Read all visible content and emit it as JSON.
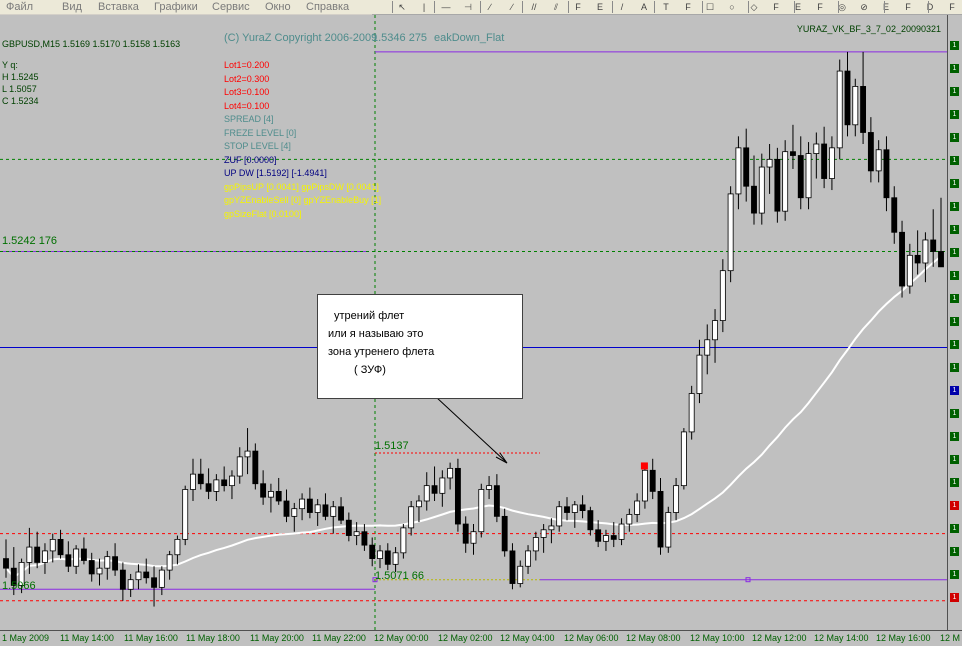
{
  "menu": {
    "items": [
      "Файл",
      "Вид",
      "Вставка",
      "Графики",
      "Сервис",
      "Окно",
      "Справка"
    ]
  },
  "toolbar": {
    "buttons": [
      "↖",
      "|",
      "—",
      "⊣",
      "∕",
      "∕",
      "//",
      "⫽",
      "F",
      "E",
      "/",
      "A",
      "T",
      "F",
      "☐",
      "○",
      "◇",
      "F",
      "E",
      "F",
      "◎",
      "⊘",
      "E",
      "F",
      "D",
      "F"
    ]
  },
  "chart": {
    "symbol_header": "GBPUSD,M15  1.5169 1.5170 1.5158 1.5163",
    "indicator_name": "YURAZ_VK_BF_3_7_02_20090321",
    "copyright": "(C) YuraZ Copyright 2006-2009",
    "overlay_number": "1.5346 275",
    "overlay_name": "eakDown_Flat",
    "ohlc": [
      "Y q:",
      "H 1.5245",
      "L 1.5057",
      "C 1.5234"
    ],
    "info": [
      {
        "text": "Lot1=0.200",
        "color": "#ff0000"
      },
      {
        "text": "Lot2=0.300",
        "color": "#ff0000"
      },
      {
        "text": "Lot3=0.100",
        "color": "#ff0000"
      },
      {
        "text": "Lot4=0.100",
        "color": "#ff0000"
      },
      {
        "text": "SPREAD      [4]",
        "color": "#4e8c8c"
      },
      {
        "text": "FREZE LEVEL [0]",
        "color": "#4e8c8c"
      },
      {
        "text": "STOP LEVEL  [4]",
        "color": "#4e8c8c"
      },
      {
        "text": "ZUF      [0.0000]",
        "color": "#000080"
      },
      {
        "text": "UP DW     [1.5192]  [-1.4941]",
        "color": "#000080"
      },
      {
        "text": "gpPipsUP [0.0041] gpPipsDW [0.0041]",
        "color": "#f5f500"
      },
      {
        "text": "gpYZEnableSell [0] gpYZEnableBuy [1]",
        "color": "#f5f500"
      },
      {
        "text": "gpSizeFlat [0.0100]",
        "color": "#f5f500"
      }
    ],
    "level_labels": {
      "high": "1.5242 176",
      "flat_top": "1.5137",
      "flat_bottom": "1.5071 66",
      "low": "1.5066"
    },
    "annotation": [
      "утрений флет",
      "или я называю это",
      "зона утренего флета",
      "( ЗУФ)"
    ],
    "time_labels": [
      "1 May 2009",
      "11 May 14:00",
      "11 May 16:00",
      "11 May 18:00",
      "11 May 20:00",
      "11 May 22:00",
      "12 May 00:00",
      "12 May 02:00",
      "12 May 04:00",
      "12 May 06:00",
      "12 May 08:00",
      "12 May 10:00",
      "12 May 12:00",
      "12 May 14:00",
      "12 May 16:00",
      "12 M"
    ],
    "price_scale_marks": [
      "1",
      "1",
      "1",
      "1",
      "1",
      "1",
      "1",
      "1",
      "1",
      "1",
      "1",
      "1",
      "1",
      "1",
      "1",
      "1",
      "1",
      "1",
      "1",
      "1",
      "1",
      "1",
      "1",
      "1",
      "1"
    ],
    "colors": {
      "background": "#c0c0c0",
      "bull_candle": "#ffffff",
      "bear_candle": "#000000",
      "ma_line": "#ffffff",
      "purple_level": "#8a2be2",
      "blue_level": "#0000cc",
      "red_level": "#ff0000",
      "green_level": "#008000",
      "yellow_level": "#b8b800",
      "grid": "#008000"
    }
  },
  "chart_data": {
    "type": "candlestick",
    "symbol": "GBPUSD",
    "timeframe": "M15",
    "candles": [
      {
        "o": 1.5082,
        "h": 1.5092,
        "l": 1.5072,
        "c": 1.5077
      },
      {
        "o": 1.5077,
        "h": 1.5088,
        "l": 1.5063,
        "c": 1.5068
      },
      {
        "o": 1.5068,
        "h": 1.5082,
        "l": 1.5064,
        "c": 1.508
      },
      {
        "o": 1.508,
        "h": 1.5098,
        "l": 1.5074,
        "c": 1.5088
      },
      {
        "o": 1.5088,
        "h": 1.5096,
        "l": 1.5077,
        "c": 1.508
      },
      {
        "o": 1.508,
        "h": 1.509,
        "l": 1.5074,
        "c": 1.5086
      },
      {
        "o": 1.5086,
        "h": 1.5095,
        "l": 1.508,
        "c": 1.5092
      },
      {
        "o": 1.5092,
        "h": 1.5097,
        "l": 1.5082,
        "c": 1.5084
      },
      {
        "o": 1.5084,
        "h": 1.5091,
        "l": 1.5075,
        "c": 1.5078
      },
      {
        "o": 1.5078,
        "h": 1.5089,
        "l": 1.5074,
        "c": 1.5087
      },
      {
        "o": 1.5087,
        "h": 1.5093,
        "l": 1.5079,
        "c": 1.5081
      },
      {
        "o": 1.5081,
        "h": 1.5085,
        "l": 1.507,
        "c": 1.5074
      },
      {
        "o": 1.5074,
        "h": 1.5082,
        "l": 1.5068,
        "c": 1.5077
      },
      {
        "o": 1.5077,
        "h": 1.5086,
        "l": 1.5071,
        "c": 1.5083
      },
      {
        "o": 1.5083,
        "h": 1.509,
        "l": 1.5073,
        "c": 1.5076
      },
      {
        "o": 1.5076,
        "h": 1.508,
        "l": 1.506,
        "c": 1.5066
      },
      {
        "o": 1.5066,
        "h": 1.5074,
        "l": 1.5062,
        "c": 1.5071
      },
      {
        "o": 1.5071,
        "h": 1.5079,
        "l": 1.5066,
        "c": 1.5075
      },
      {
        "o": 1.5075,
        "h": 1.5082,
        "l": 1.5069,
        "c": 1.5072
      },
      {
        "o": 1.5072,
        "h": 1.5078,
        "l": 1.5057,
        "c": 1.5067
      },
      {
        "o": 1.5067,
        "h": 1.5078,
        "l": 1.5063,
        "c": 1.5076
      },
      {
        "o": 1.5076,
        "h": 1.5086,
        "l": 1.5071,
        "c": 1.5084
      },
      {
        "o": 1.5084,
        "h": 1.5094,
        "l": 1.5079,
        "c": 1.5092
      },
      {
        "o": 1.5092,
        "h": 1.512,
        "l": 1.5089,
        "c": 1.5118
      },
      {
        "o": 1.5118,
        "h": 1.5134,
        "l": 1.5112,
        "c": 1.5126
      },
      {
        "o": 1.5126,
        "h": 1.5134,
        "l": 1.5118,
        "c": 1.5121
      },
      {
        "o": 1.5121,
        "h": 1.5129,
        "l": 1.5113,
        "c": 1.5117
      },
      {
        "o": 1.5117,
        "h": 1.5126,
        "l": 1.5112,
        "c": 1.5123
      },
      {
        "o": 1.5123,
        "h": 1.513,
        "l": 1.5117,
        "c": 1.512
      },
      {
        "o": 1.512,
        "h": 1.5128,
        "l": 1.5113,
        "c": 1.5125
      },
      {
        "o": 1.5125,
        "h": 1.514,
        "l": 1.5121,
        "c": 1.5135
      },
      {
        "o": 1.5135,
        "h": 1.515,
        "l": 1.5126,
        "c": 1.5138
      },
      {
        "o": 1.5138,
        "h": 1.5142,
        "l": 1.5118,
        "c": 1.5121
      },
      {
        "o": 1.5121,
        "h": 1.5128,
        "l": 1.511,
        "c": 1.5114
      },
      {
        "o": 1.5114,
        "h": 1.5121,
        "l": 1.5106,
        "c": 1.5117
      },
      {
        "o": 1.5117,
        "h": 1.5124,
        "l": 1.511,
        "c": 1.5112
      },
      {
        "o": 1.5112,
        "h": 1.5118,
        "l": 1.5101,
        "c": 1.5104
      },
      {
        "o": 1.5104,
        "h": 1.5111,
        "l": 1.5096,
        "c": 1.5108
      },
      {
        "o": 1.5108,
        "h": 1.5116,
        "l": 1.5102,
        "c": 1.5113
      },
      {
        "o": 1.5113,
        "h": 1.5119,
        "l": 1.5103,
        "c": 1.5106
      },
      {
        "o": 1.5106,
        "h": 1.5113,
        "l": 1.5099,
        "c": 1.511
      },
      {
        "o": 1.511,
        "h": 1.5116,
        "l": 1.5102,
        "c": 1.5104
      },
      {
        "o": 1.5104,
        "h": 1.5112,
        "l": 1.5095,
        "c": 1.5109
      },
      {
        "o": 1.5109,
        "h": 1.5114,
        "l": 1.51,
        "c": 1.5102
      },
      {
        "o": 1.5102,
        "h": 1.5106,
        "l": 1.5091,
        "c": 1.5094
      },
      {
        "o": 1.5094,
        "h": 1.5101,
        "l": 1.5089,
        "c": 1.5096
      },
      {
        "o": 1.5096,
        "h": 1.51,
        "l": 1.5086,
        "c": 1.5089
      },
      {
        "o": 1.5089,
        "h": 1.5093,
        "l": 1.5078,
        "c": 1.5082
      },
      {
        "o": 1.5082,
        "h": 1.5089,
        "l": 1.5077,
        "c": 1.5086
      },
      {
        "o": 1.5086,
        "h": 1.509,
        "l": 1.5076,
        "c": 1.5079
      },
      {
        "o": 1.5079,
        "h": 1.5088,
        "l": 1.5075,
        "c": 1.5085
      },
      {
        "o": 1.5085,
        "h": 1.51,
        "l": 1.5082,
        "c": 1.5098
      },
      {
        "o": 1.5098,
        "h": 1.5112,
        "l": 1.5094,
        "c": 1.5109
      },
      {
        "o": 1.5109,
        "h": 1.5115,
        "l": 1.5101,
        "c": 1.5112
      },
      {
        "o": 1.5112,
        "h": 1.5127,
        "l": 1.5107,
        "c": 1.512
      },
      {
        "o": 1.512,
        "h": 1.513,
        "l": 1.5112,
        "c": 1.5116
      },
      {
        "o": 1.5116,
        "h": 1.5128,
        "l": 1.5109,
        "c": 1.5124
      },
      {
        "o": 1.5124,
        "h": 1.5132,
        "l": 1.5118,
        "c": 1.5129
      },
      {
        "o": 1.5129,
        "h": 1.5134,
        "l": 1.5096,
        "c": 1.51
      },
      {
        "o": 1.51,
        "h": 1.5104,
        "l": 1.5085,
        "c": 1.509
      },
      {
        "o": 1.509,
        "h": 1.51,
        "l": 1.5084,
        "c": 1.5096
      },
      {
        "o": 1.5096,
        "h": 1.5121,
        "l": 1.5093,
        "c": 1.5118
      },
      {
        "o": 1.5118,
        "h": 1.5125,
        "l": 1.5113,
        "c": 1.512
      },
      {
        "o": 1.512,
        "h": 1.5126,
        "l": 1.5101,
        "c": 1.5104
      },
      {
        "o": 1.5104,
        "h": 1.5108,
        "l": 1.5083,
        "c": 1.5086
      },
      {
        "o": 1.5086,
        "h": 1.509,
        "l": 1.5066,
        "c": 1.5069
      },
      {
        "o": 1.5069,
        "h": 1.5081,
        "l": 1.5067,
        "c": 1.5078
      },
      {
        "o": 1.5078,
        "h": 1.5089,
        "l": 1.5074,
        "c": 1.5086
      },
      {
        "o": 1.5086,
        "h": 1.5096,
        "l": 1.5081,
        "c": 1.5093
      },
      {
        "o": 1.5093,
        "h": 1.51,
        "l": 1.5085,
        "c": 1.5097
      },
      {
        "o": 1.5097,
        "h": 1.5103,
        "l": 1.509,
        "c": 1.5099
      },
      {
        "o": 1.5099,
        "h": 1.5112,
        "l": 1.5096,
        "c": 1.5109
      },
      {
        "o": 1.5109,
        "h": 1.5114,
        "l": 1.5102,
        "c": 1.5106
      },
      {
        "o": 1.5106,
        "h": 1.5112,
        "l": 1.5098,
        "c": 1.511
      },
      {
        "o": 1.511,
        "h": 1.5115,
        "l": 1.5103,
        "c": 1.5107
      },
      {
        "o": 1.5107,
        "h": 1.5109,
        "l": 1.5094,
        "c": 1.5097
      },
      {
        "o": 1.5097,
        "h": 1.5102,
        "l": 1.5088,
        "c": 1.5091
      },
      {
        "o": 1.5091,
        "h": 1.5097,
        "l": 1.5086,
        "c": 1.5094
      },
      {
        "o": 1.5094,
        "h": 1.5101,
        "l": 1.5088,
        "c": 1.5092
      },
      {
        "o": 1.5092,
        "h": 1.5103,
        "l": 1.5089,
        "c": 1.51
      },
      {
        "o": 1.51,
        "h": 1.5108,
        "l": 1.5096,
        "c": 1.5105
      },
      {
        "o": 1.5105,
        "h": 1.5116,
        "l": 1.5101,
        "c": 1.5112
      },
      {
        "o": 1.5112,
        "h": 1.5132,
        "l": 1.5108,
        "c": 1.5128
      },
      {
        "o": 1.5128,
        "h": 1.5134,
        "l": 1.5113,
        "c": 1.5117
      },
      {
        "o": 1.5117,
        "h": 1.5124,
        "l": 1.5084,
        "c": 1.5088
      },
      {
        "o": 1.5088,
        "h": 1.5109,
        "l": 1.5085,
        "c": 1.5106
      },
      {
        "o": 1.5106,
        "h": 1.5124,
        "l": 1.5102,
        "c": 1.512
      },
      {
        "o": 1.512,
        "h": 1.515,
        "l": 1.5118,
        "c": 1.5148
      },
      {
        "o": 1.5148,
        "h": 1.5172,
        "l": 1.5144,
        "c": 1.5168
      },
      {
        "o": 1.5168,
        "h": 1.5196,
        "l": 1.5163,
        "c": 1.5188
      },
      {
        "o": 1.5188,
        "h": 1.5204,
        "l": 1.5178,
        "c": 1.5196
      },
      {
        "o": 1.5196,
        "h": 1.5212,
        "l": 1.5184,
        "c": 1.5206
      },
      {
        "o": 1.5206,
        "h": 1.5238,
        "l": 1.52,
        "c": 1.5232
      },
      {
        "o": 1.5232,
        "h": 1.5276,
        "l": 1.5226,
        "c": 1.5272
      },
      {
        "o": 1.5272,
        "h": 1.5302,
        "l": 1.5264,
        "c": 1.5296
      },
      {
        "o": 1.5296,
        "h": 1.5306,
        "l": 1.5268,
        "c": 1.5276
      },
      {
        "o": 1.5276,
        "h": 1.5292,
        "l": 1.5256,
        "c": 1.5262
      },
      {
        "o": 1.5262,
        "h": 1.5293,
        "l": 1.5256,
        "c": 1.5286
      },
      {
        "o": 1.5286,
        "h": 1.5298,
        "l": 1.5272,
        "c": 1.529
      },
      {
        "o": 1.529,
        "h": 1.5296,
        "l": 1.5257,
        "c": 1.5263
      },
      {
        "o": 1.5263,
        "h": 1.53,
        "l": 1.5258,
        "c": 1.5294
      },
      {
        "o": 1.5294,
        "h": 1.5308,
        "l": 1.5285,
        "c": 1.5292
      },
      {
        "o": 1.5292,
        "h": 1.5302,
        "l": 1.5264,
        "c": 1.527
      },
      {
        "o": 1.527,
        "h": 1.5299,
        "l": 1.5264,
        "c": 1.5293
      },
      {
        "o": 1.5293,
        "h": 1.5304,
        "l": 1.528,
        "c": 1.5298
      },
      {
        "o": 1.5298,
        "h": 1.5307,
        "l": 1.5275,
        "c": 1.528
      },
      {
        "o": 1.528,
        "h": 1.5302,
        "l": 1.5274,
        "c": 1.5296
      },
      {
        "o": 1.5296,
        "h": 1.5342,
        "l": 1.529,
        "c": 1.5336
      },
      {
        "o": 1.5336,
        "h": 1.5346,
        "l": 1.5302,
        "c": 1.5308
      },
      {
        "o": 1.5308,
        "h": 1.5332,
        "l": 1.5302,
        "c": 1.5328
      },
      {
        "o": 1.5328,
        "h": 1.5346,
        "l": 1.5298,
        "c": 1.5304
      },
      {
        "o": 1.5304,
        "h": 1.5312,
        "l": 1.5278,
        "c": 1.5284
      },
      {
        "o": 1.5284,
        "h": 1.53,
        "l": 1.5278,
        "c": 1.5295
      },
      {
        "o": 1.5295,
        "h": 1.5302,
        "l": 1.5263,
        "c": 1.527
      },
      {
        "o": 1.527,
        "h": 1.5276,
        "l": 1.5246,
        "c": 1.5252
      },
      {
        "o": 1.5252,
        "h": 1.5258,
        "l": 1.5218,
        "c": 1.5224
      },
      {
        "o": 1.5224,
        "h": 1.5246,
        "l": 1.522,
        "c": 1.524
      },
      {
        "o": 1.524,
        "h": 1.5253,
        "l": 1.523,
        "c": 1.5236
      },
      {
        "o": 1.5236,
        "h": 1.5252,
        "l": 1.5226,
        "c": 1.5248
      },
      {
        "o": 1.5248,
        "h": 1.5264,
        "l": 1.5234,
        "c": 1.5242
      },
      {
        "o": 1.5242,
        "h": 1.527,
        "l": 1.5236,
        "c": 1.5234
      }
    ],
    "levels": [
      {
        "name": "upper-purple",
        "price": 1.5346
      },
      {
        "name": "mid-green",
        "price": 1.5242
      },
      {
        "name": "blue",
        "price": 1.5192
      },
      {
        "name": "flat-top",
        "price": 1.5137
      },
      {
        "name": "red-mid",
        "price": 1.5095
      },
      {
        "name": "flat-bottom",
        "price": 1.5071
      },
      {
        "name": "low-purple",
        "price": 1.5066
      }
    ],
    "ylim": [
      1.505,
      1.536
    ]
  }
}
